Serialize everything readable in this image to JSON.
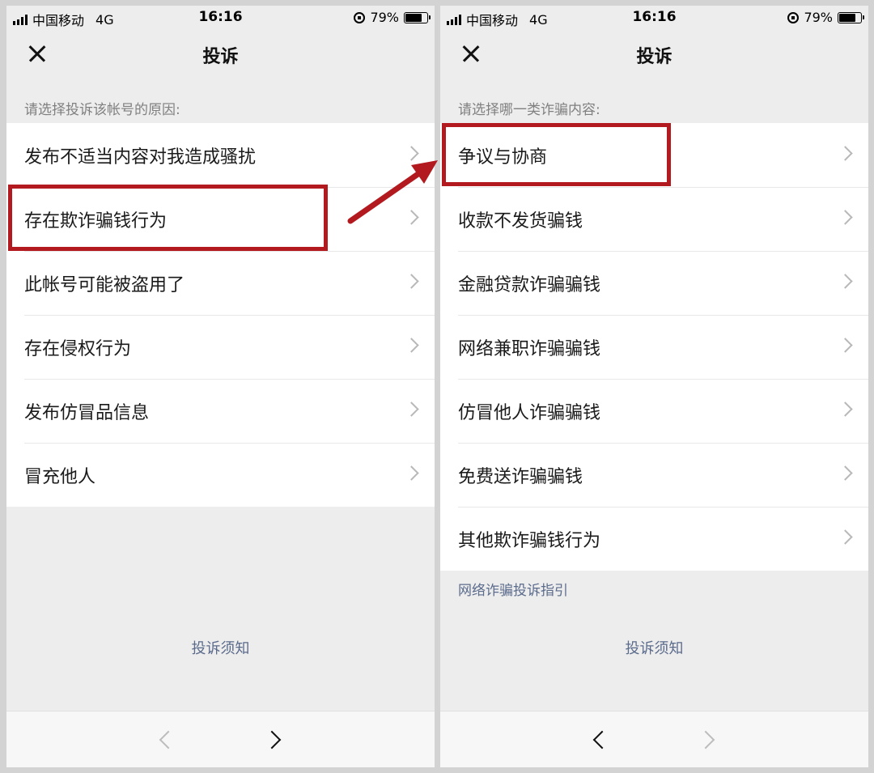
{
  "status_bar": {
    "carrier": "中国移动",
    "network": "4G",
    "time": "16:16",
    "battery_text": "79%",
    "battery_level_percent": 79
  },
  "left_screen": {
    "title": "投诉",
    "hint": "请选择投诉该帐号的原因:",
    "items": [
      {
        "label": "发布不适当内容对我造成骚扰"
      },
      {
        "label": "存在欺诈骗钱行为"
      },
      {
        "label": "此帐号可能被盗用了"
      },
      {
        "label": "存在侵权行为"
      },
      {
        "label": "发布仿冒品信息"
      },
      {
        "label": "冒充他人"
      }
    ],
    "notice_link": "投诉须知",
    "toolbar": {
      "back_enabled": false,
      "forward_enabled": true
    }
  },
  "right_screen": {
    "title": "投诉",
    "hint": "请选择哪一类诈骗内容:",
    "items": [
      {
        "label": "争议与协商"
      },
      {
        "label": "收款不发货骗钱"
      },
      {
        "label": "金融贷款诈骗骗钱"
      },
      {
        "label": "网络兼职诈骗骗钱"
      },
      {
        "label": "仿冒他人诈骗骗钱"
      },
      {
        "label": "免费送诈骗骗钱"
      },
      {
        "label": "其他欺诈骗钱行为"
      }
    ],
    "guide_link": "网络诈骗投诉指引",
    "notice_link": "投诉须知",
    "toolbar": {
      "back_enabled": true,
      "forward_enabled": false
    }
  },
  "colors": {
    "highlight": "#b31a1f",
    "link": "#5b6b8c",
    "background": "#ededed"
  }
}
